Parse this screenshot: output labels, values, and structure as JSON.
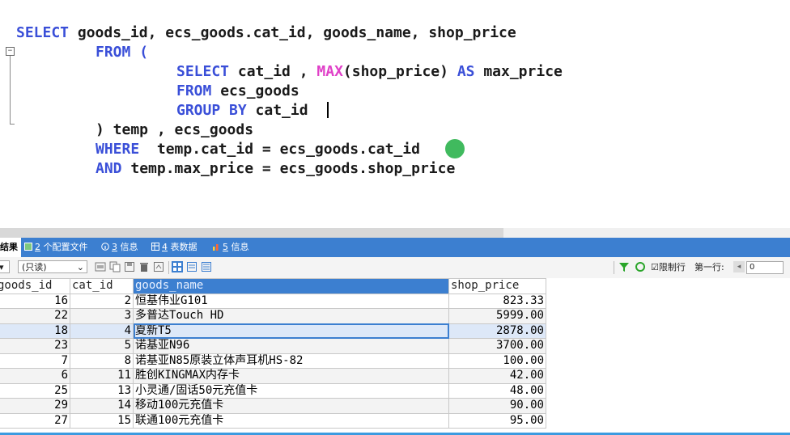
{
  "editor": {
    "lines": [
      {
        "parts": [
          {
            "t": "SELECT",
            "c": "kw"
          },
          {
            "t": " goods_id, ecs_goods.cat_id, goods_name, shop_price"
          }
        ]
      },
      {
        "parts": [
          {
            "t": "FROM",
            "c": "kw"
          },
          {
            "t": " "
          },
          {
            "t": "(",
            "c": "kw"
          }
        ]
      },
      {
        "parts": [
          {
            "t": "SELECT",
            "c": "kw"
          },
          {
            "t": " cat_id , "
          },
          {
            "t": "MAX",
            "c": "fn"
          },
          {
            "t": "(shop_price) "
          },
          {
            "t": "AS",
            "c": "kw"
          },
          {
            "t": " max_price"
          }
        ]
      },
      {
        "parts": [
          {
            "t": "FROM",
            "c": "kw"
          },
          {
            "t": " ecs_goods"
          }
        ]
      },
      {
        "parts": [
          {
            "t": "GROUP BY",
            "c": "kw"
          },
          {
            "t": " cat_id"
          }
        ]
      },
      {
        "parts": [
          {
            "t": ") temp , ecs_goods"
          }
        ]
      },
      {
        "parts": [
          {
            "t": "WHERE",
            "c": "kw"
          },
          {
            "t": "  temp.cat_id = ecs_goods.cat_id"
          }
        ]
      },
      {
        "parts": [
          {
            "t": "AND",
            "c": "kw"
          },
          {
            "t": " temp.max_price = ecs_goods.shop_price"
          }
        ]
      }
    ],
    "fold_symbol": "−"
  },
  "tabs": {
    "result": "结果",
    "config_num": "2",
    "config_label": "个配置文件",
    "info_num": "3",
    "info_label": "信息",
    "table_num": "4",
    "table_label": "表数据",
    "info2_num": "5",
    "info2_label": "信息"
  },
  "toolbar": {
    "mode": "(只读)",
    "limit_label": "限制行",
    "first_row_label": "第一行:",
    "first_row_value": "0"
  },
  "grid": {
    "columns": [
      "goods_id",
      "cat_id",
      "goods_name",
      "shop_price"
    ],
    "rows": [
      [
        "16",
        "2",
        "恒基伟业G101",
        "823.33"
      ],
      [
        "22",
        "3",
        "多普达Touch HD",
        "5999.00"
      ],
      [
        "18",
        "4",
        "夏新T5",
        "2878.00"
      ],
      [
        "23",
        "5",
        "诺基亚N96",
        "3700.00"
      ],
      [
        "7",
        "8",
        "诺基亚N85原装立体声耳机HS-82",
        "100.00"
      ],
      [
        "6",
        "11",
        "胜创KINGMAX内存卡",
        "42.00"
      ],
      [
        "25",
        "13",
        "小灵通/固话50元充值卡",
        "48.00"
      ],
      [
        "29",
        "14",
        "移动100元充值卡",
        "90.00"
      ],
      [
        "27",
        "15",
        "联通100元充值卡",
        "95.00"
      ]
    ],
    "selected_row": 2,
    "selected_column": 2
  },
  "colors": {
    "keyword": "#3a4fd8",
    "function": "#e040c8",
    "accent": "#3c7fd0",
    "cursor": "#2bb24c"
  }
}
